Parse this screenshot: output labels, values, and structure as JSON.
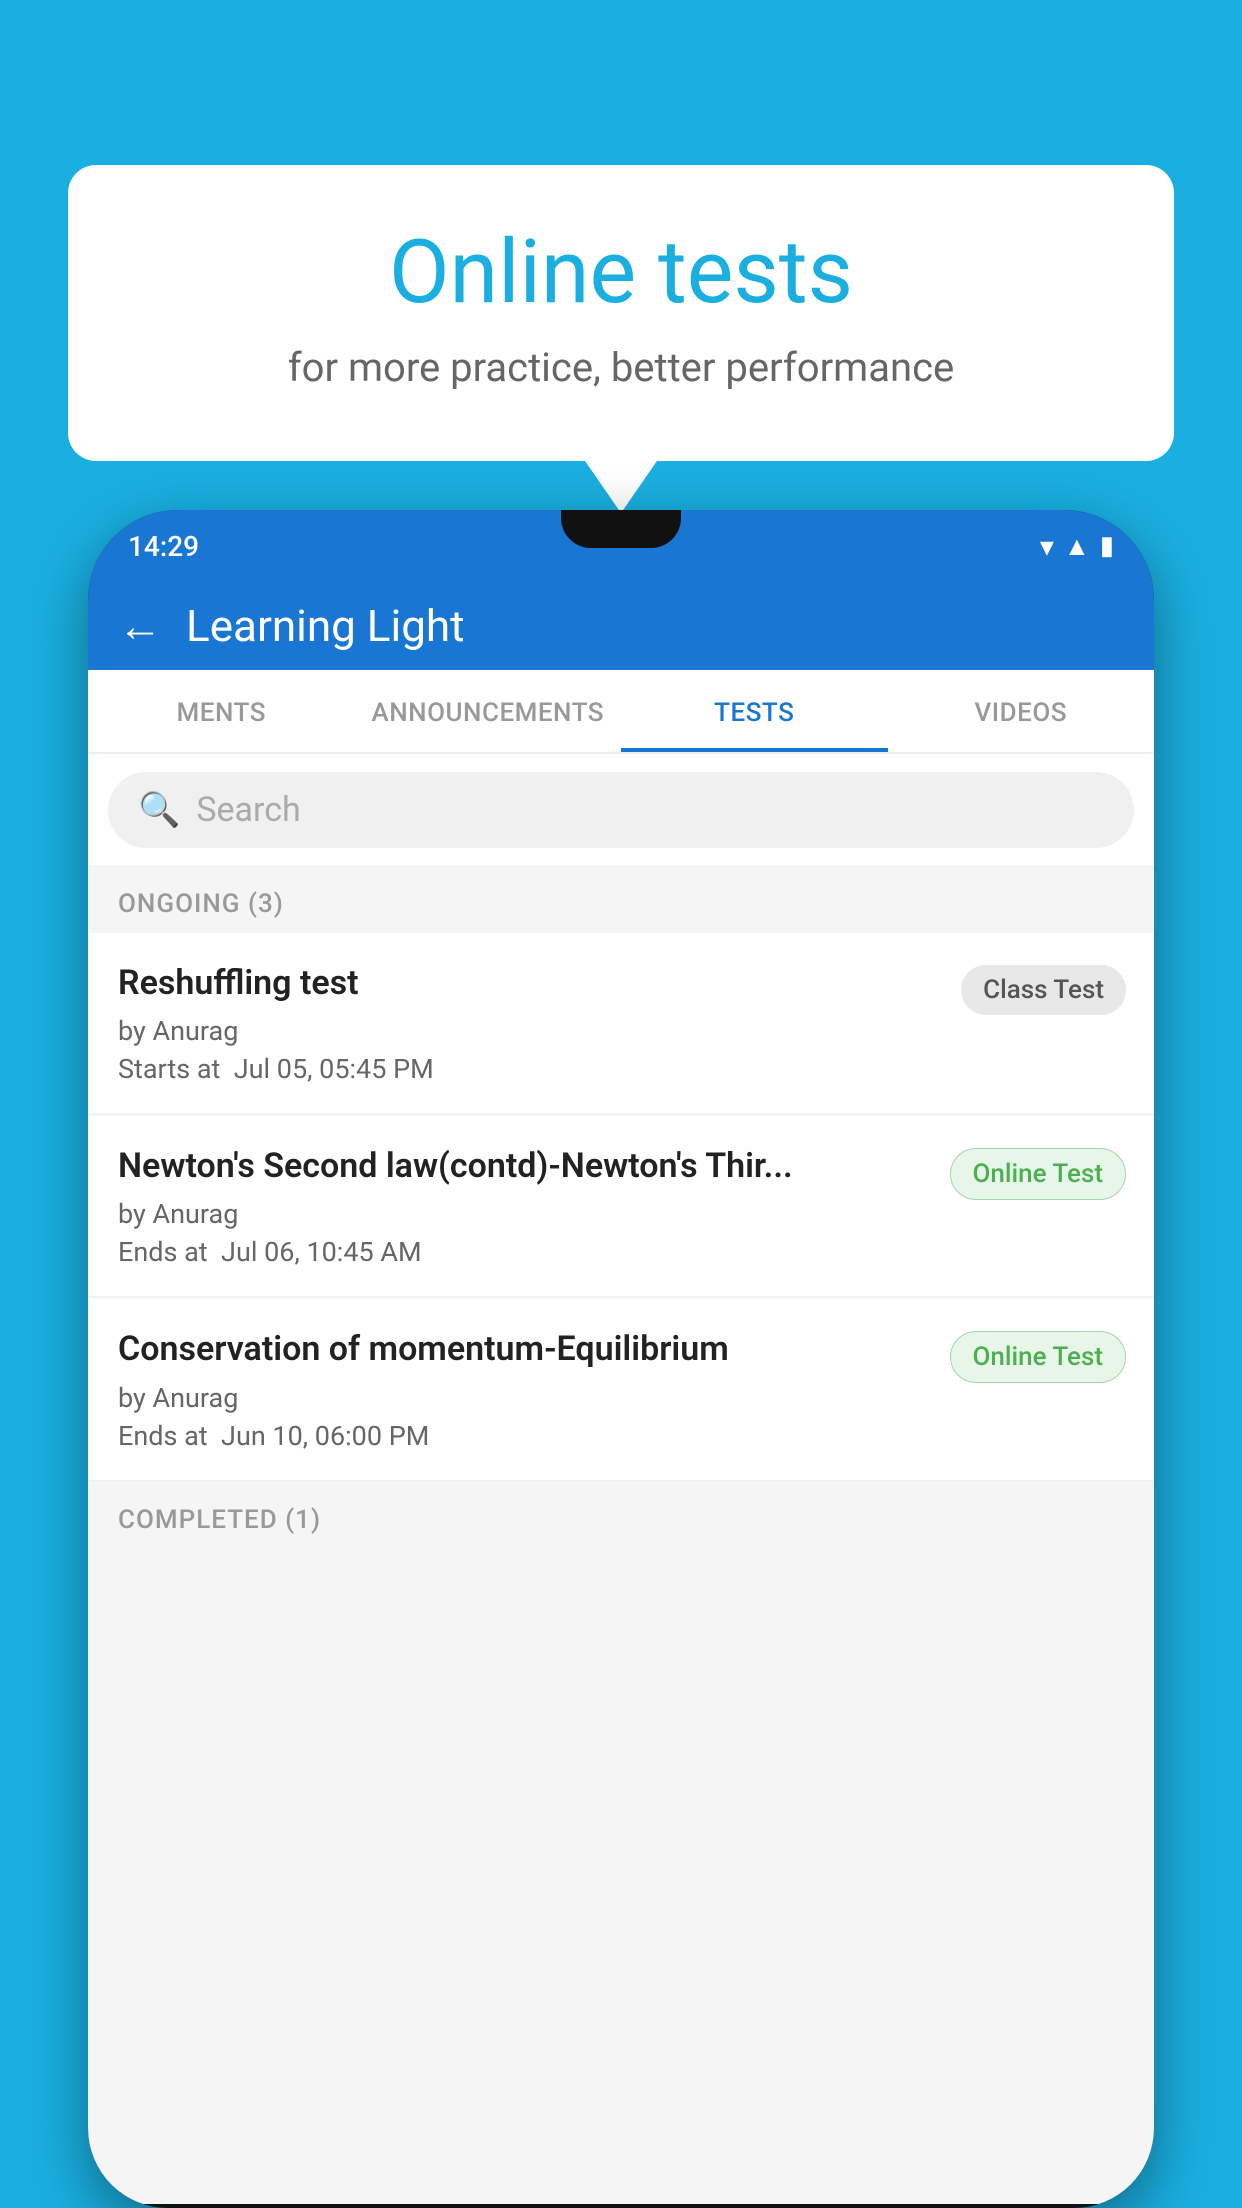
{
  "background_color": "#1AAFE0",
  "speech_bubble": {
    "title": "Online tests",
    "subtitle": "for more practice, better performance"
  },
  "phone": {
    "status_bar": {
      "time": "14:29",
      "icons": [
        "wifi",
        "signal",
        "battery"
      ]
    },
    "app_header": {
      "back_label": "←",
      "title": "Learning Light"
    },
    "tabs": [
      {
        "label": "MENTS",
        "active": false
      },
      {
        "label": "ANNOUNCEMENTS",
        "active": false
      },
      {
        "label": "TESTS",
        "active": true
      },
      {
        "label": "VIDEOS",
        "active": false
      }
    ],
    "search": {
      "placeholder": "Search"
    },
    "ongoing_section": {
      "header": "ONGOING (3)",
      "items": [
        {
          "name": "Reshuffling test",
          "author": "by Anurag",
          "time_label": "Starts at",
          "time": "Jul 05, 05:45 PM",
          "badge": "Class Test",
          "badge_type": "class"
        },
        {
          "name": "Newton's Second law(contd)-Newton's Thir...",
          "author": "by Anurag",
          "time_label": "Ends at",
          "time": "Jul 06, 10:45 AM",
          "badge": "Online Test",
          "badge_type": "online"
        },
        {
          "name": "Conservation of momentum-Equilibrium",
          "author": "by Anurag",
          "time_label": "Ends at",
          "time": "Jun 10, 06:00 PM",
          "badge": "Online Test",
          "badge_type": "online"
        }
      ]
    },
    "completed_section": {
      "header": "COMPLETED (1)"
    }
  }
}
